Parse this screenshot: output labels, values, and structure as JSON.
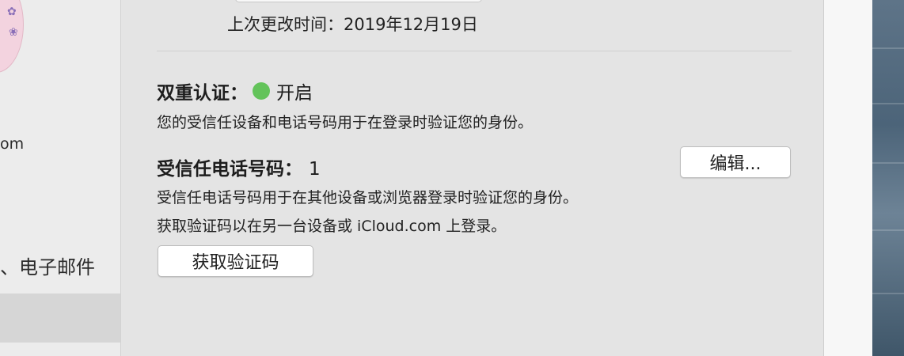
{
  "sidebar": {
    "email_fragment": "om",
    "item_label": "、电子邮件"
  },
  "main": {
    "last_change": "上次更改时间：2019年12月19日",
    "two_factor": {
      "title": "双重认证：",
      "status": "开启",
      "status_color": "#63c35a",
      "description": "您的受信任设备和电话号码用于在登录时验证您的身份。"
    },
    "trusted_phone": {
      "title": "受信任电话号码：",
      "count": "1",
      "edit_label": "编辑...",
      "description": "受信任电话号码用于在其他设备或浏览器登录时验证您的身份。",
      "code_hint": "获取验证码以在另一台设备或 iCloud.com 上登录。",
      "get_code_label": "获取验证码"
    }
  }
}
